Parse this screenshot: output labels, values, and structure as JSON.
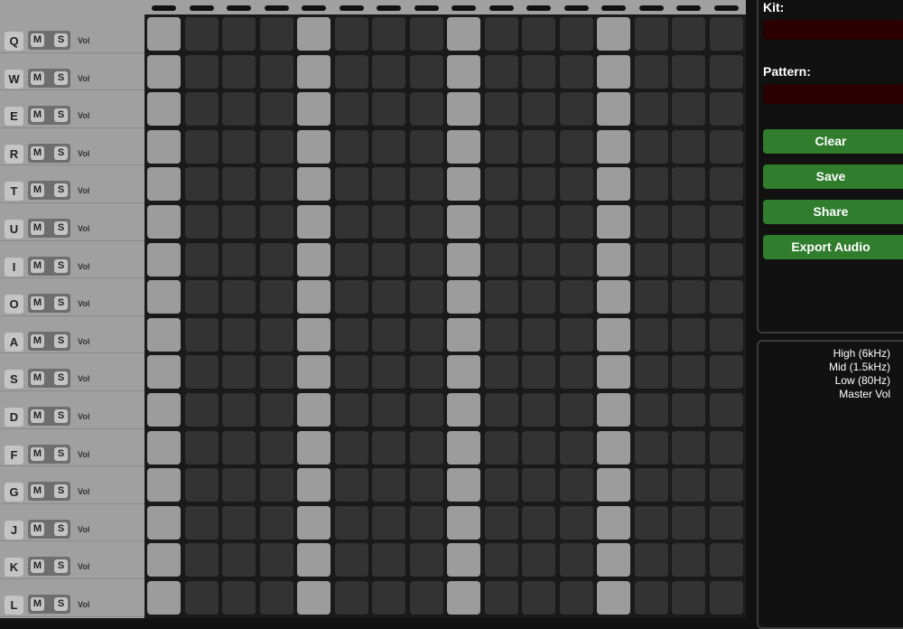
{
  "tracks": [
    {
      "key": "Q"
    },
    {
      "key": "W"
    },
    {
      "key": "E"
    },
    {
      "key": "R"
    },
    {
      "key": "T"
    },
    {
      "key": "U"
    },
    {
      "key": "I"
    },
    {
      "key": "O"
    },
    {
      "key": "A"
    },
    {
      "key": "S"
    },
    {
      "key": "D"
    },
    {
      "key": "F"
    },
    {
      "key": "G"
    },
    {
      "key": "J"
    },
    {
      "key": "K"
    },
    {
      "key": "L"
    }
  ],
  "track_controls": {
    "mute": "M",
    "solo": "S",
    "vol": "Vol"
  },
  "step_count": 16,
  "active_steps": [
    1,
    5,
    9,
    13
  ],
  "colors": {
    "step_on": "#9c9c9c",
    "step_off": "#333333",
    "button": "#2f7d2d",
    "field": "#2a0000"
  },
  "sidebar": {
    "kit_label": "Kit:",
    "kit_value": "",
    "pattern_label": "Pattern:",
    "pattern_value": "",
    "buttons": [
      "Clear",
      "Save",
      "Share",
      "Export Audio"
    ]
  },
  "eq": {
    "labels": [
      "High (6kHz)",
      "Mid (1.5kHz)",
      "Low (80Hz)",
      "Master Vol"
    ]
  }
}
